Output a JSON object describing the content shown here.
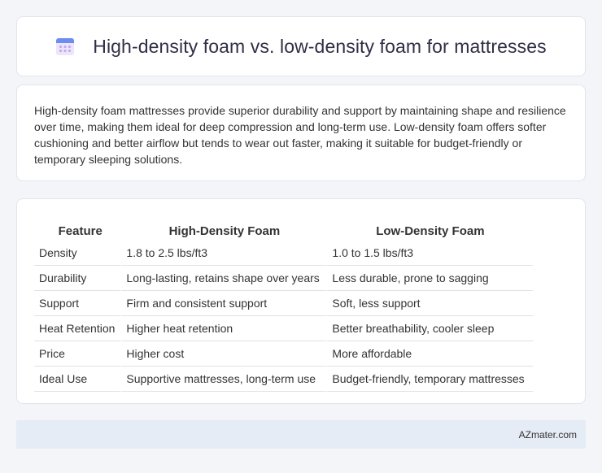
{
  "header": {
    "title": "High-density foam vs. low-density foam for mattresses",
    "icon": "calendar-icon"
  },
  "intro": {
    "text": "High-density foam mattresses provide superior durability and support by maintaining shape and resilience over time, making them ideal for deep compression and long-term use. Low-density foam offers softer cushioning and better airflow but tends to wear out faster, making it suitable for budget-friendly or temporary sleeping solutions."
  },
  "table": {
    "headers": [
      "Feature",
      "High-Density Foam",
      "Low-Density Foam"
    ],
    "rows": [
      [
        "Density",
        "1.8 to 2.5 lbs/ft3",
        "1.0 to 1.5 lbs/ft3"
      ],
      [
        "Durability",
        "Long-lasting, retains shape over years",
        "Less durable, prone to sagging"
      ],
      [
        "Support",
        "Firm and consistent support",
        "Soft, less support"
      ],
      [
        "Heat Retention",
        "Higher heat retention",
        "Better breathability, cooler sleep"
      ],
      [
        "Price",
        "Higher cost",
        "More affordable"
      ],
      [
        "Ideal Use",
        "Supportive mattresses, long-term use",
        "Budget-friendly, temporary mattresses"
      ]
    ]
  },
  "footer": {
    "site": "AZmater.com"
  },
  "colors": {
    "background": "#f3f5f9",
    "card": "#ffffff",
    "footer": "#e6ecf5",
    "icon_top": "#6d8ef0",
    "icon_body": "#ece6fb"
  }
}
